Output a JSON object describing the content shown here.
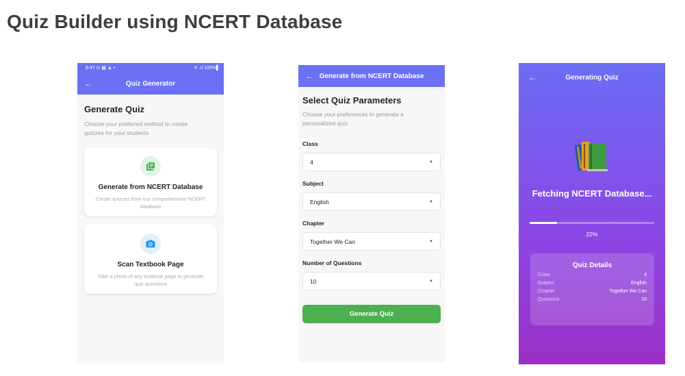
{
  "page": {
    "title": "Quiz Builder using NCERT Database"
  },
  "colors": {
    "primary": "#6b70f5",
    "green": "#4caf50",
    "gradient_end": "#9b2fc6"
  },
  "phone1": {
    "status": {
      "time": "8:47",
      "icons": "⊙ ▩ ▲ •",
      "right": "✕ .ıl 100%▌"
    },
    "appbar": {
      "back_icon": "←",
      "title": "Quiz Generator"
    },
    "heading": "Generate Quiz",
    "subtitle": "Choose your preferred method to create quizzes for your students",
    "cards": [
      {
        "icon": "library-books-icon",
        "title": "Generate from NCERT Database",
        "description": "Create quizzes from our comprehensive NCERT database"
      },
      {
        "icon": "camera-icon",
        "title": "Scan Textbook Page",
        "description": "Take a photo of any textbook page to generate quiz questions"
      }
    ]
  },
  "phone2": {
    "appbar": {
      "back_icon": "←",
      "title": "Generate from NCERT Database"
    },
    "heading": "Select Quiz Parameters",
    "subtitle": "Choose your preferences to generate a personalized quiz",
    "fields": [
      {
        "label": "Class",
        "value": "4"
      },
      {
        "label": "Subject",
        "value": "English"
      },
      {
        "label": "Chapter",
        "value": "Together We Can"
      },
      {
        "label": "Number of Questions",
        "value": "10"
      }
    ],
    "caret": "▼",
    "button_label": "Generate Quiz"
  },
  "phone3": {
    "appbar": {
      "back_icon": "←",
      "title": "Generating Quiz"
    },
    "status_text": "Fetching NCERT Database...",
    "progress": {
      "fraction": 0.22,
      "label": "22%"
    },
    "details": {
      "title": "Quiz Details",
      "rows": [
        {
          "key": "Class",
          "value": "4"
        },
        {
          "key": "Subject",
          "value": "English"
        },
        {
          "key": "Chapter",
          "value": "Together We Can"
        },
        {
          "key": "Questions",
          "value": "10"
        }
      ]
    }
  }
}
